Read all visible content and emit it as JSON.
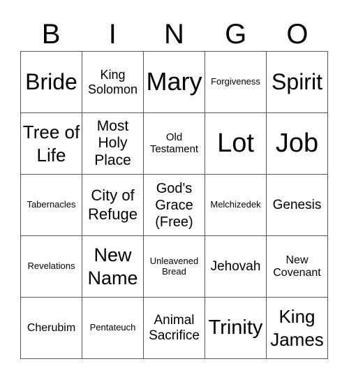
{
  "header": {
    "letters": [
      "B",
      "I",
      "N",
      "G",
      "O"
    ]
  },
  "card": {
    "rows": [
      [
        "Bride",
        "King Solomon",
        "Mary",
        "Forgiveness",
        "Spirit"
      ],
      [
        "Tree of Life",
        "Most Holy Place",
        "Old Testament",
        "Lot",
        "Job"
      ],
      [
        "Tabernacles",
        "City of Refuge",
        "God's Grace (Free)",
        "Melchizedek",
        "Genesis"
      ],
      [
        "Revelations",
        "New Name",
        "Unleavened Bread",
        "Jehovah",
        "New Covenant"
      ],
      [
        "Cherubim",
        "Pentateuch",
        "Animal Sacrifice",
        "Trinity",
        "King James"
      ]
    ]
  },
  "colors": {
    "text": "#000000",
    "grid_line": "#555555",
    "background": "#ffffff"
  }
}
